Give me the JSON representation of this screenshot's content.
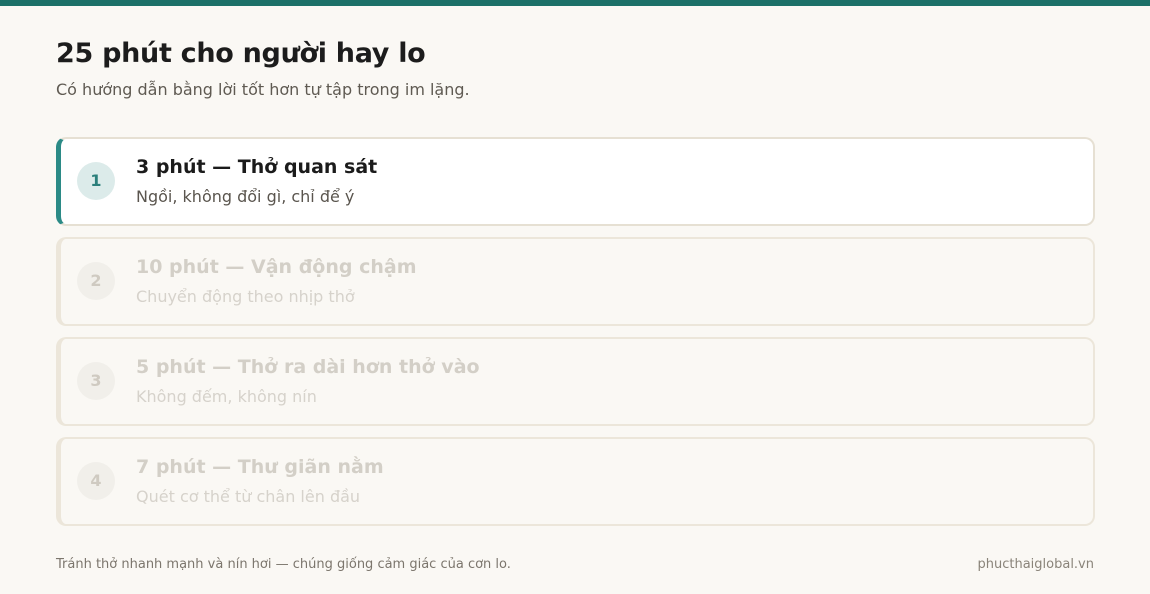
{
  "header": {
    "title": "25 phút cho người hay lo",
    "subtitle": "Có hướng dẫn bằng lời tốt hơn tự tập trong im lặng."
  },
  "steps": [
    {
      "number": "1",
      "title": "3 phút — Thở quan sát",
      "description": "Ngồi, không đổi gì, chỉ để ý",
      "active": true
    },
    {
      "number": "2",
      "title": "10 phút — Vận động chậm",
      "description": "Chuyển động theo nhịp thở",
      "active": false
    },
    {
      "number": "3",
      "title": "5 phút — Thở ra dài hơn thở vào",
      "description": "Không đếm, không nín",
      "active": false
    },
    {
      "number": "4",
      "title": "7 phút — Thư giãn nằm",
      "description": "Quét cơ thể từ chân lên đầu",
      "active": false
    }
  ],
  "footer": {
    "note": "Tránh thở nhanh mạnh và nín hơi — chúng giống cảm giác của cơn lo.",
    "site": "phucthaiglobal.vn"
  },
  "colors": {
    "accent": "#1c7068",
    "active_border": "#2b8a86",
    "background": "#faf8f4"
  }
}
